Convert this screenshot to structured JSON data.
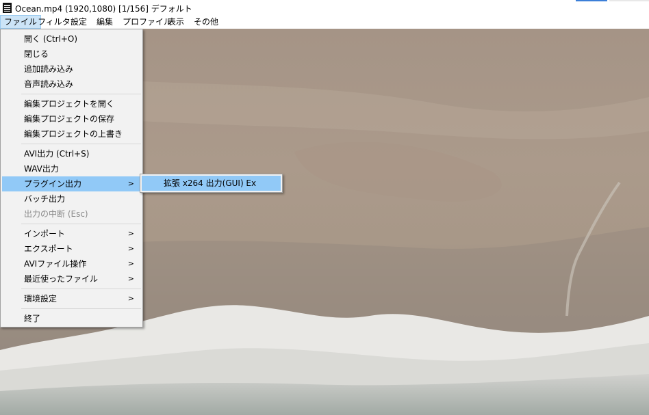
{
  "window": {
    "title": "Ocean.mp4 (1920,1080)  [1/156]  デフォルト",
    "icon": "filmstrip-icon"
  },
  "menubar": {
    "items": [
      "ファイル",
      "フィルタ",
      "設定",
      "編集",
      "プロファイル",
      "表示",
      "その他"
    ],
    "active": "ファイル"
  },
  "file_menu": {
    "items": [
      {
        "label": "開く (Ctrl+O)"
      },
      {
        "label": "閉じる"
      },
      {
        "label": "追加読み込み"
      },
      {
        "label": "音声読み込み"
      },
      {
        "label": "編集プロジェクトを開く"
      },
      {
        "label": "編集プロジェクトの保存"
      },
      {
        "label": "編集プロジェクトの上書き"
      },
      {
        "label": "AVI出力 (Ctrl+S)"
      },
      {
        "label": "WAV出力"
      },
      {
        "label": "プラグイン出力",
        "highlighted": true,
        "submenu": true
      },
      {
        "label": "バッチ出力"
      },
      {
        "label": "出力の中断 (Esc)",
        "disabled": true
      },
      {
        "label": "インポート",
        "submenu": true
      },
      {
        "label": "エクスポート",
        "submenu": true
      },
      {
        "label": "AVIファイル操作",
        "submenu": true
      },
      {
        "label": "最近使ったファイル",
        "submenu": true
      },
      {
        "label": "環境設定",
        "submenu": true
      },
      {
        "label": "終了"
      }
    ],
    "submenu_arrow": ">"
  },
  "plugin_output_submenu": {
    "items": [
      {
        "label": "拡張 x264 出力(GUI) Ex",
        "highlighted": true
      }
    ]
  },
  "colors": {
    "menu_background": "#f2f2f2",
    "menu_highlight": "#91c9f7",
    "menubar_active": "#cce4f7",
    "disabled_text": "#8a8a8a"
  }
}
